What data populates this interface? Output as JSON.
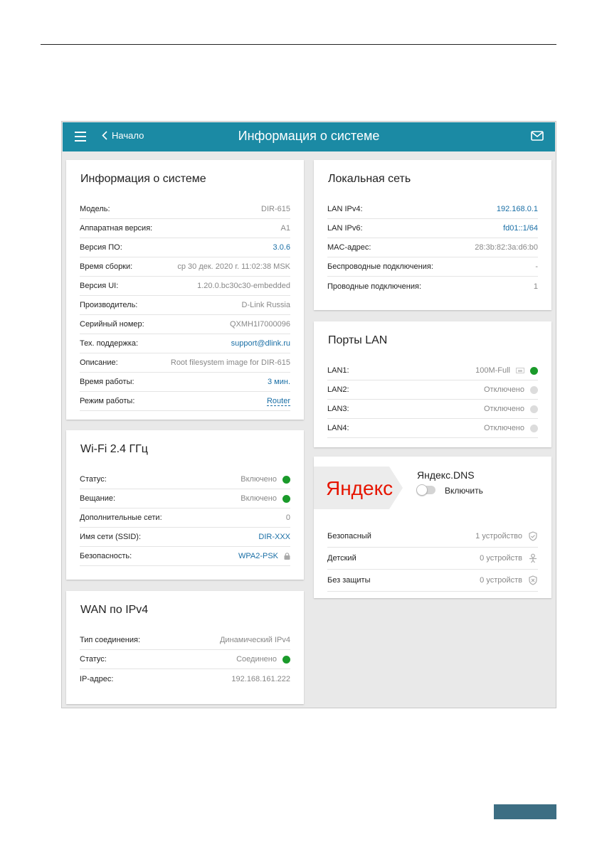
{
  "header": {
    "back_label": "Начало",
    "title": "Информация о системе"
  },
  "system": {
    "title": "Информация о системе",
    "rows": [
      {
        "label": "Модель:",
        "value": "DIR-615"
      },
      {
        "label": "Аппаратная версия:",
        "value": "A1"
      },
      {
        "label": "Версия ПО:",
        "value": "3.0.6"
      },
      {
        "label": "Время сборки:",
        "value": "ср 30 дек. 2020 г. 11:02:38 MSK"
      },
      {
        "label": "Версия UI:",
        "value": "1.20.0.bc30c30-embedded"
      },
      {
        "label": "Производитель:",
        "value": "D-Link Russia"
      },
      {
        "label": "Серийный номер:",
        "value": "QXMH1I7000096"
      },
      {
        "label": "Тех. поддержка:",
        "value": "support@dlink.ru"
      },
      {
        "label": "Описание:",
        "value": "Root filesystem image for DIR-615"
      },
      {
        "label": "Время работы:",
        "value": "3 мин."
      },
      {
        "label": "Режим работы:",
        "value": "Router"
      }
    ]
  },
  "wifi": {
    "title": "Wi-Fi 2.4 ГГц",
    "rows": [
      {
        "label": "Статус:",
        "value": "Включено"
      },
      {
        "label": "Вещание:",
        "value": "Включено"
      },
      {
        "label": "Дополнительные сети:",
        "value": "0"
      },
      {
        "label": "Имя сети (SSID):",
        "value": "DIR-XXX"
      },
      {
        "label": "Безопасность:",
        "value": "WPA2-PSK"
      }
    ]
  },
  "wan": {
    "title": "WAN по IPv4",
    "rows": [
      {
        "label": "Тип соединения:",
        "value": "Динамический IPv4"
      },
      {
        "label": "Статус:",
        "value": "Соединено"
      },
      {
        "label": "IP-адрес:",
        "value": "192.168.161.222"
      }
    ]
  },
  "lan": {
    "title": "Локальная сеть",
    "rows": [
      {
        "label": "LAN IPv4:",
        "value": "192.168.0.1"
      },
      {
        "label": "LAN IPv6:",
        "value": "fd01::1/64"
      },
      {
        "label": "MAC-адрес:",
        "value": "28:3b:82:3a:d6:b0"
      },
      {
        "label": "Беспроводные подключения:",
        "value": "-"
      },
      {
        "label": "Проводные подключения:",
        "value": "1"
      }
    ]
  },
  "ports": {
    "title": "Порты LAN",
    "rows": [
      {
        "label": "LAN1:",
        "value": "100M-Full"
      },
      {
        "label": "LAN2:",
        "value": "Отключено"
      },
      {
        "label": "LAN3:",
        "value": "Отключено"
      },
      {
        "label": "LAN4:",
        "value": "Отключено"
      }
    ]
  },
  "yandex": {
    "logo_text": "Яндекс",
    "title": "Яндекс.DNS",
    "toggle_label": "Включить",
    "rows": [
      {
        "label": "Безопасный",
        "value": "1 устройство"
      },
      {
        "label": "Детский",
        "value": "0 устройств"
      },
      {
        "label": "Без защиты",
        "value": "0 устройств"
      }
    ]
  },
  "colors": {
    "header": "#1b8aa4",
    "link": "#1a6fa6",
    "status_on": "#1a9a2a",
    "status_off": "#dcdcdc",
    "yandex_red": "#e61400",
    "page_tab": "#3d6e83"
  }
}
